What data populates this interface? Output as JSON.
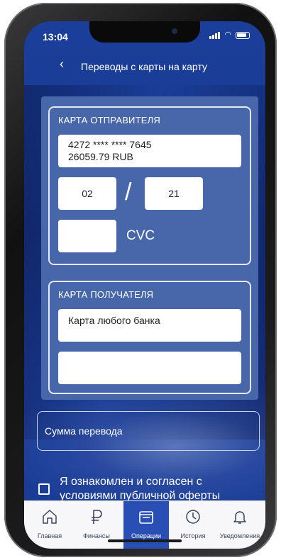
{
  "status": {
    "time": "13:04"
  },
  "header": {
    "title": "Переводы с карты на карту"
  },
  "sender": {
    "label": "КАРТА ОТПРАВИТЕЛЯ",
    "card_number": "4272 **** **** 7645",
    "balance": "26059.79 RUB",
    "month": "02",
    "separator": "/",
    "year": "21",
    "cvc_value": "",
    "cvc_label": "CVC"
  },
  "receiver": {
    "label": "КАРТА ПОЛУЧАТЕЛЯ",
    "card_type": "Карта любого банка",
    "card_number": ""
  },
  "amount": {
    "placeholder": "Сумма перевода"
  },
  "agreement": {
    "text": "Я ознакомлен и согласен с условиями публичной оферты",
    "checked": false
  },
  "tabs": [
    {
      "label": "Главная",
      "icon": "home-icon",
      "active": false
    },
    {
      "label": "Финансы",
      "icon": "ruble-icon",
      "active": false
    },
    {
      "label": "Операции",
      "icon": "wallet-icon",
      "active": true
    },
    {
      "label": "История",
      "icon": "clock-icon",
      "active": false
    },
    {
      "label": "Уведомления",
      "icon": "bell-icon",
      "active": false
    }
  ],
  "colors": {
    "accent": "#2a4fb4",
    "panel": "#4767aa",
    "background": "#1a3d96"
  }
}
